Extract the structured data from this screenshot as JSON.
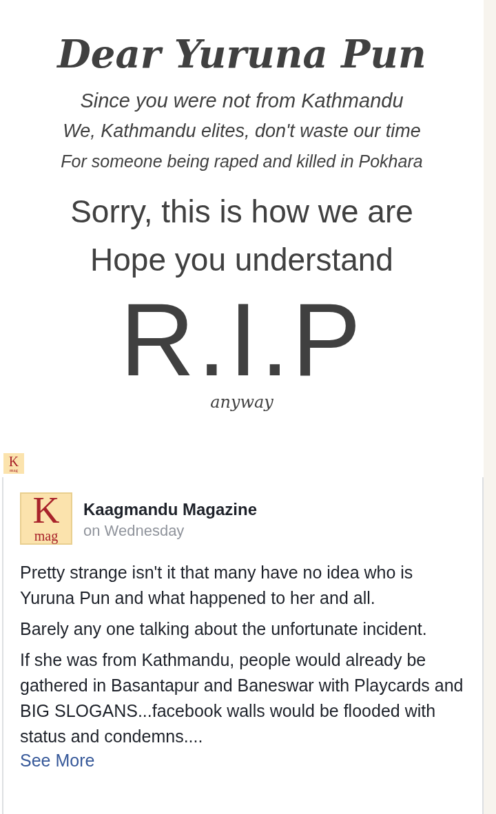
{
  "poster": {
    "title": "Dear Yuruna Pun",
    "lines": [
      "Since you were not from Kathmandu",
      "We, Kathmandu elites, don't waste our time",
      "For someone being raped and killed in Pokhara"
    ],
    "message": [
      "Sorry, this is how we are",
      "Hope you understand"
    ],
    "big": "R.I.P",
    "footer": "anyway"
  },
  "small_logo": {
    "letter": "K",
    "sub": "mag"
  },
  "post": {
    "logo": {
      "letter": "K",
      "sub": "mag"
    },
    "author": "Kaagmandu Magazine",
    "time": "on Wednesday",
    "paragraphs": [
      "Pretty strange isn't it that many have no idea who is Yuruna Pun and what happened to her and all.",
      "Barely any one talking about the unfortunate incident.",
      "If she was from Kathmandu, people would already be gathered in Basantapur and Baneswar with Playcards and BIG SLOGANS...facebook walls would be flooded with status and condemns...."
    ],
    "see_more": "See More"
  }
}
